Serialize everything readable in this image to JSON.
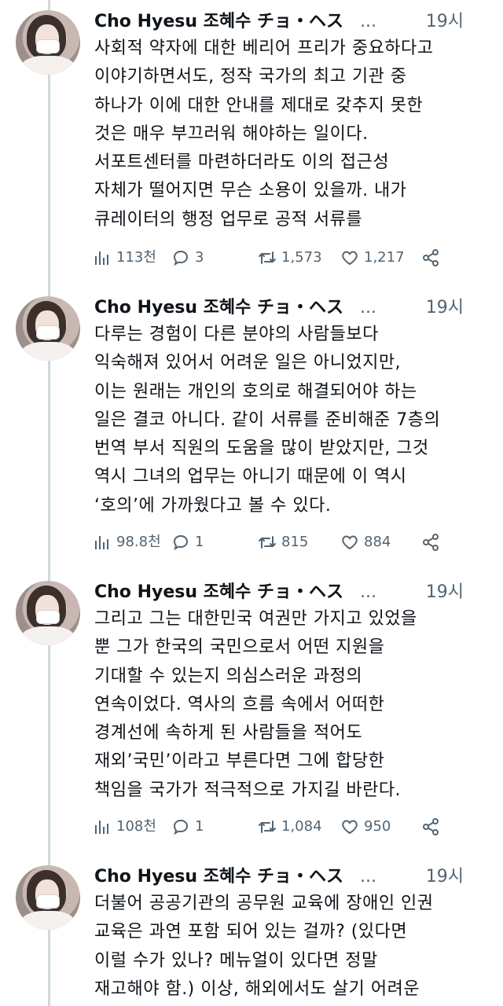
{
  "author": {
    "display_name": "Cho Hyesu 조혜수 チョ・ヘス",
    "truncation": "..."
  },
  "tweets": [
    {
      "time": "19시",
      "lines": [
        "사회적 약자에 대한 베리어 프리가 중요하다고",
        "이야기하면서도, 정작 국가의 최고 기관 중",
        "하나가 이에 대한 안내를 제대로 갖추지 못한",
        "것은 매우 부끄러워 해야하는 일이다.",
        "서포트센터를 마련하더라도 이의 접근성",
        "자체가 떨어지면 무슨 소용이 있을까. 내가",
        "큐레이터의 행정 업무로 공적 서류를"
      ],
      "views": "113천",
      "replies": "3",
      "retweets": "1,573",
      "likes": "1,217"
    },
    {
      "time": "19시",
      "lines": [
        "다루는 경험이 다른 분야의 사람들보다",
        "익숙해져 있어서 어려운 일은 아니었지만,",
        "이는 원래는 개인의 호의로 해결되어야 하는",
        "일은 결코 아니다. 같이 서류를 준비해준 7층의",
        "번역 부서 직원의 도움을 많이 받았지만, 그것",
        "역시 그녀의 업무는 아니기 때문에 이 역시",
        "‘호의’에 가까웠다고 볼 수 있다."
      ],
      "views": "98.8천",
      "replies": "1",
      "retweets": "815",
      "likes": "884"
    },
    {
      "time": "19시",
      "lines": [
        "그리고 그는 대한민국 여권만 가지고 있었을",
        "뿐 그가 한국의 국민으로서 어떤 지원을",
        "기대할 수 있는지 의심스러운 과정의",
        "연속이었다. 역사의 흐름 속에서 어떠한",
        "경계선에 속하게 된 사람들을 적어도",
        "재외’국민’이라고 부른다면 그에 합당한",
        "책임을 국가가 적극적으로 가지길 바란다."
      ],
      "views": "108천",
      "replies": "1",
      "retweets": "1,084",
      "likes": "950"
    },
    {
      "time": "19시",
      "lines": [
        "더불어 공공기관의 공무원 교육에 장애인 인권",
        "교육은 과연 포함 되어 있는 걸까? (있다면",
        "이럴 수가 있나? 메뉴얼이 있다면 정말",
        "재고해야 함.) 이상, 해외에서도 살기 어려운"
      ]
    }
  ]
}
